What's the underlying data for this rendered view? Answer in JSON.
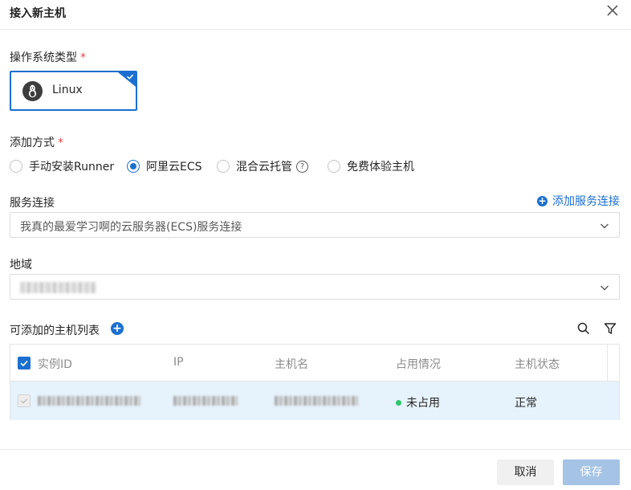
{
  "dialog": {
    "title": "接入新主机"
  },
  "os_type": {
    "label": "操作系统类型",
    "required_mark": "*",
    "selected": {
      "name": "Linux",
      "icon": "linux-penguin-icon"
    }
  },
  "add_method": {
    "label": "添加方式",
    "required_mark": "*",
    "options": [
      {
        "label": "手动安装Runner",
        "selected": false
      },
      {
        "label": "阿里云ECS",
        "selected": true
      },
      {
        "label": "混合云托管",
        "selected": false,
        "help": "?"
      },
      {
        "label": "免费体验主机",
        "selected": false
      }
    ]
  },
  "service_connection": {
    "label": "服务连接",
    "add_link": "添加服务连接",
    "add_icon": "+",
    "value": "我真的最爱学习啊的云服务器(ECS)服务连接"
  },
  "region": {
    "label": "地域"
  },
  "host_list": {
    "title": "可添加的主机列表",
    "add_icon": "+",
    "columns": [
      "实例ID",
      "IP",
      "主机名",
      "占用情况",
      "主机状态"
    ],
    "rows": [
      {
        "occupancy": "未占用",
        "status": "正常"
      }
    ]
  },
  "footer": {
    "cancel": "取消",
    "save": "保存"
  },
  "colors": {
    "primary": "#1b6fd0",
    "success": "#2ec56b",
    "required": "#e5484d",
    "save_disabled": "#a5c3e5"
  }
}
